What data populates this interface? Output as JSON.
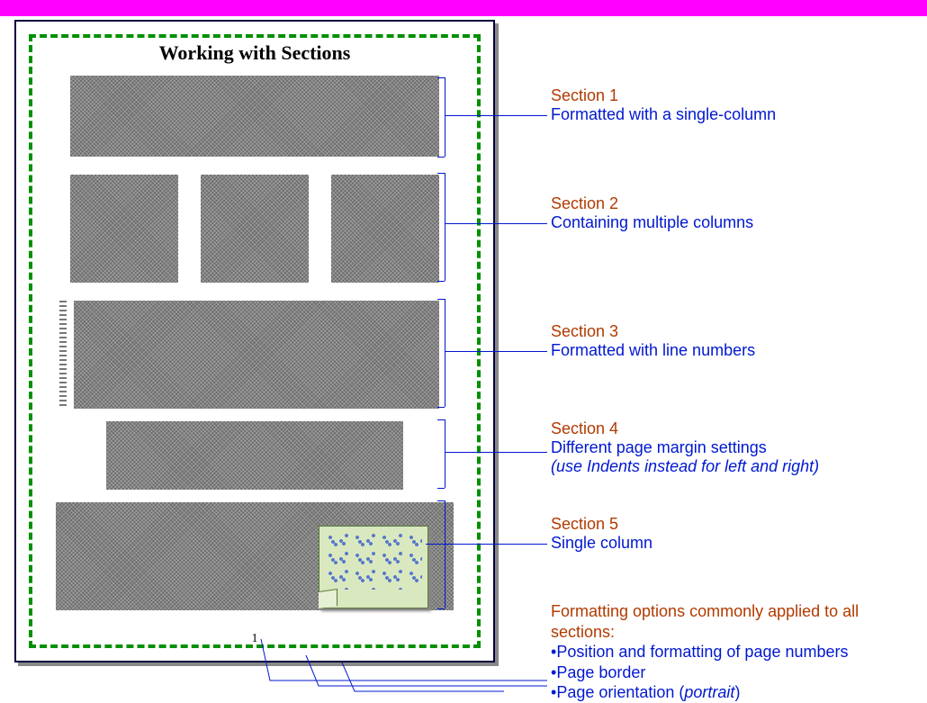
{
  "page": {
    "title": "Working with Sections",
    "page_label": "1"
  },
  "annotations": {
    "section1": {
      "head": "Section 1",
      "desc": "Formatted with a single-column"
    },
    "section2": {
      "head": "Section 2",
      "desc": "Containing multiple columns"
    },
    "section3": {
      "head": "Section 3",
      "desc": "Formatted with line numbers"
    },
    "section4": {
      "head": "Section 4",
      "desc": "Different page margin settings",
      "note": "(use Indents instead for left and right)"
    },
    "section5": {
      "head": "Section 5",
      "desc": "Single column"
    }
  },
  "common_options": {
    "head": "Formatting options commonly applied to all sections:",
    "items": [
      "Position and formatting of page numbers",
      "Page border",
      "Page orientation (portrait)"
    ]
  }
}
